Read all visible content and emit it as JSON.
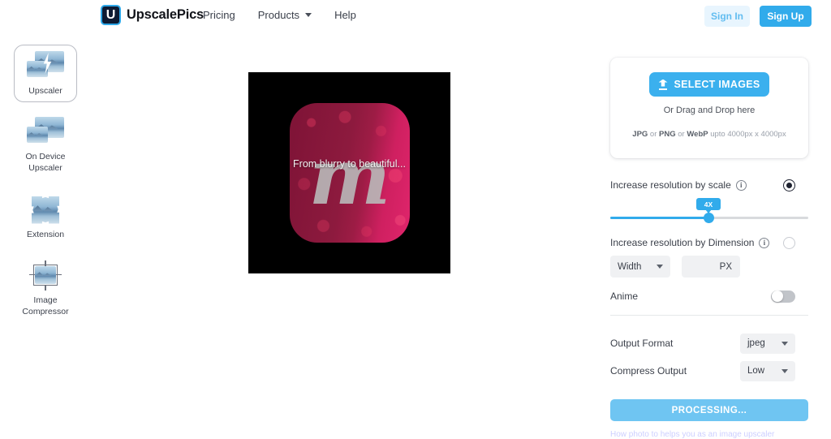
{
  "header": {
    "brand": {
      "logo_letter": "U",
      "name": "UpscalePics"
    },
    "nav": [
      {
        "label": "Pricing",
        "has_caret": false
      },
      {
        "label": "Products",
        "has_caret": true
      },
      {
        "label": "Help",
        "has_caret": false
      }
    ],
    "sign_in": "Sign In",
    "sign_up": "Sign Up"
  },
  "sidebar": {
    "items": [
      {
        "label": "Upscaler",
        "icon": "upscaler-icon",
        "active": true
      },
      {
        "label": "On Device Upscaler",
        "icon": "on-device-upscaler-icon",
        "active": false
      },
      {
        "label": "Extension",
        "icon": "extension-puzzle-icon",
        "active": false
      },
      {
        "label": "Image Compressor",
        "icon": "image-compressor-icon",
        "active": false
      }
    ]
  },
  "preview": {
    "overlay_text": "From blurry to beautiful...",
    "app_icon_glyph": "m",
    "background_color": "#000000",
    "icon_color": "#9d1c45"
  },
  "panel": {
    "upload": {
      "select_button": "SELECT IMAGES",
      "drag_text": "Or Drag and Drop here",
      "formats": {
        "jpg": "JPG",
        "or1": " or ",
        "png": "PNG",
        "or2": " or ",
        "webp": "WebP",
        "limit": " upto 4000px x 4000px"
      }
    },
    "scale": {
      "label": "Increase resolution by scale",
      "selected": true,
      "value": "4X",
      "slider_percent": 50
    },
    "dimension": {
      "label": "Increase resolution by Dimension",
      "selected": false,
      "width_select": "Width",
      "px_field_value": "PX",
      "px_placeholder": "PX"
    },
    "anime": {
      "label": "Anime",
      "enabled": false
    },
    "output_format": {
      "label": "Output Format",
      "value": "jpeg"
    },
    "compress_output": {
      "label": "Compress Output",
      "value": "Low"
    },
    "action_button": "PROCESSING...",
    "footer_note": "How photo to helps you as an image upscaler"
  },
  "colors": {
    "accent": "#31abeb",
    "accent_light": "#6fc5f2",
    "signin_bg": "#e8f5fe",
    "panel_field": "#f0f1f3"
  }
}
